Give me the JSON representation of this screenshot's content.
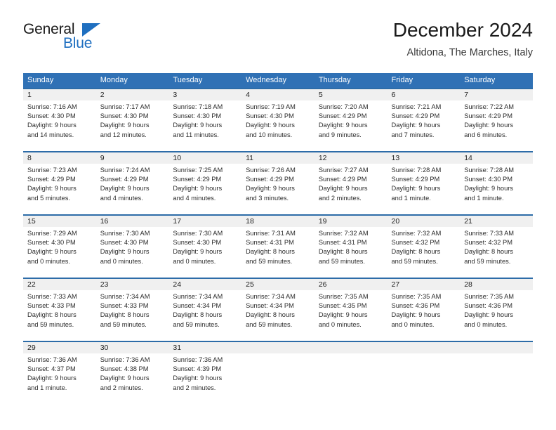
{
  "brand": {
    "name_part1": "General",
    "name_part2": "Blue",
    "accent_color": "#1f6fc0"
  },
  "header": {
    "title": "December 2024",
    "subtitle": "Altidona, The Marches, Italy"
  },
  "theme": {
    "header_blue": "#3071b5",
    "divider_blue": "#2d6ca8",
    "daynum_band": "#f0f0f0"
  },
  "weekdays": [
    "Sunday",
    "Monday",
    "Tuesday",
    "Wednesday",
    "Thursday",
    "Friday",
    "Saturday"
  ],
  "weeks": [
    [
      {
        "day": "1",
        "sunrise": "Sunrise: 7:16 AM",
        "sunset": "Sunset: 4:30 PM",
        "daylight1": "Daylight: 9 hours",
        "daylight2": "and 14 minutes."
      },
      {
        "day": "2",
        "sunrise": "Sunrise: 7:17 AM",
        "sunset": "Sunset: 4:30 PM",
        "daylight1": "Daylight: 9 hours",
        "daylight2": "and 12 minutes."
      },
      {
        "day": "3",
        "sunrise": "Sunrise: 7:18 AM",
        "sunset": "Sunset: 4:30 PM",
        "daylight1": "Daylight: 9 hours",
        "daylight2": "and 11 minutes."
      },
      {
        "day": "4",
        "sunrise": "Sunrise: 7:19 AM",
        "sunset": "Sunset: 4:30 PM",
        "daylight1": "Daylight: 9 hours",
        "daylight2": "and 10 minutes."
      },
      {
        "day": "5",
        "sunrise": "Sunrise: 7:20 AM",
        "sunset": "Sunset: 4:29 PM",
        "daylight1": "Daylight: 9 hours",
        "daylight2": "and 9 minutes."
      },
      {
        "day": "6",
        "sunrise": "Sunrise: 7:21 AM",
        "sunset": "Sunset: 4:29 PM",
        "daylight1": "Daylight: 9 hours",
        "daylight2": "and 7 minutes."
      },
      {
        "day": "7",
        "sunrise": "Sunrise: 7:22 AM",
        "sunset": "Sunset: 4:29 PM",
        "daylight1": "Daylight: 9 hours",
        "daylight2": "and 6 minutes."
      }
    ],
    [
      {
        "day": "8",
        "sunrise": "Sunrise: 7:23 AM",
        "sunset": "Sunset: 4:29 PM",
        "daylight1": "Daylight: 9 hours",
        "daylight2": "and 5 minutes."
      },
      {
        "day": "9",
        "sunrise": "Sunrise: 7:24 AM",
        "sunset": "Sunset: 4:29 PM",
        "daylight1": "Daylight: 9 hours",
        "daylight2": "and 4 minutes."
      },
      {
        "day": "10",
        "sunrise": "Sunrise: 7:25 AM",
        "sunset": "Sunset: 4:29 PM",
        "daylight1": "Daylight: 9 hours",
        "daylight2": "and 4 minutes."
      },
      {
        "day": "11",
        "sunrise": "Sunrise: 7:26 AM",
        "sunset": "Sunset: 4:29 PM",
        "daylight1": "Daylight: 9 hours",
        "daylight2": "and 3 minutes."
      },
      {
        "day": "12",
        "sunrise": "Sunrise: 7:27 AM",
        "sunset": "Sunset: 4:29 PM",
        "daylight1": "Daylight: 9 hours",
        "daylight2": "and 2 minutes."
      },
      {
        "day": "13",
        "sunrise": "Sunrise: 7:28 AM",
        "sunset": "Sunset: 4:29 PM",
        "daylight1": "Daylight: 9 hours",
        "daylight2": "and 1 minute."
      },
      {
        "day": "14",
        "sunrise": "Sunrise: 7:28 AM",
        "sunset": "Sunset: 4:30 PM",
        "daylight1": "Daylight: 9 hours",
        "daylight2": "and 1 minute."
      }
    ],
    [
      {
        "day": "15",
        "sunrise": "Sunrise: 7:29 AM",
        "sunset": "Sunset: 4:30 PM",
        "daylight1": "Daylight: 9 hours",
        "daylight2": "and 0 minutes."
      },
      {
        "day": "16",
        "sunrise": "Sunrise: 7:30 AM",
        "sunset": "Sunset: 4:30 PM",
        "daylight1": "Daylight: 9 hours",
        "daylight2": "and 0 minutes."
      },
      {
        "day": "17",
        "sunrise": "Sunrise: 7:30 AM",
        "sunset": "Sunset: 4:30 PM",
        "daylight1": "Daylight: 9 hours",
        "daylight2": "and 0 minutes."
      },
      {
        "day": "18",
        "sunrise": "Sunrise: 7:31 AM",
        "sunset": "Sunset: 4:31 PM",
        "daylight1": "Daylight: 8 hours",
        "daylight2": "and 59 minutes."
      },
      {
        "day": "19",
        "sunrise": "Sunrise: 7:32 AM",
        "sunset": "Sunset: 4:31 PM",
        "daylight1": "Daylight: 8 hours",
        "daylight2": "and 59 minutes."
      },
      {
        "day": "20",
        "sunrise": "Sunrise: 7:32 AM",
        "sunset": "Sunset: 4:32 PM",
        "daylight1": "Daylight: 8 hours",
        "daylight2": "and 59 minutes."
      },
      {
        "day": "21",
        "sunrise": "Sunrise: 7:33 AM",
        "sunset": "Sunset: 4:32 PM",
        "daylight1": "Daylight: 8 hours",
        "daylight2": "and 59 minutes."
      }
    ],
    [
      {
        "day": "22",
        "sunrise": "Sunrise: 7:33 AM",
        "sunset": "Sunset: 4:33 PM",
        "daylight1": "Daylight: 8 hours",
        "daylight2": "and 59 minutes."
      },
      {
        "day": "23",
        "sunrise": "Sunrise: 7:34 AM",
        "sunset": "Sunset: 4:33 PM",
        "daylight1": "Daylight: 8 hours",
        "daylight2": "and 59 minutes."
      },
      {
        "day": "24",
        "sunrise": "Sunrise: 7:34 AM",
        "sunset": "Sunset: 4:34 PM",
        "daylight1": "Daylight: 8 hours",
        "daylight2": "and 59 minutes."
      },
      {
        "day": "25",
        "sunrise": "Sunrise: 7:34 AM",
        "sunset": "Sunset: 4:34 PM",
        "daylight1": "Daylight: 8 hours",
        "daylight2": "and 59 minutes."
      },
      {
        "day": "26",
        "sunrise": "Sunrise: 7:35 AM",
        "sunset": "Sunset: 4:35 PM",
        "daylight1": "Daylight: 9 hours",
        "daylight2": "and 0 minutes."
      },
      {
        "day": "27",
        "sunrise": "Sunrise: 7:35 AM",
        "sunset": "Sunset: 4:36 PM",
        "daylight1": "Daylight: 9 hours",
        "daylight2": "and 0 minutes."
      },
      {
        "day": "28",
        "sunrise": "Sunrise: 7:35 AM",
        "sunset": "Sunset: 4:36 PM",
        "daylight1": "Daylight: 9 hours",
        "daylight2": "and 0 minutes."
      }
    ],
    [
      {
        "day": "29",
        "sunrise": "Sunrise: 7:36 AM",
        "sunset": "Sunset: 4:37 PM",
        "daylight1": "Daylight: 9 hours",
        "daylight2": "and 1 minute."
      },
      {
        "day": "30",
        "sunrise": "Sunrise: 7:36 AM",
        "sunset": "Sunset: 4:38 PM",
        "daylight1": "Daylight: 9 hours",
        "daylight2": "and 2 minutes."
      },
      {
        "day": "31",
        "sunrise": "Sunrise: 7:36 AM",
        "sunset": "Sunset: 4:39 PM",
        "daylight1": "Daylight: 9 hours",
        "daylight2": "and 2 minutes."
      },
      {
        "day": "",
        "sunrise": "",
        "sunset": "",
        "daylight1": "",
        "daylight2": ""
      },
      {
        "day": "",
        "sunrise": "",
        "sunset": "",
        "daylight1": "",
        "daylight2": ""
      },
      {
        "day": "",
        "sunrise": "",
        "sunset": "",
        "daylight1": "",
        "daylight2": ""
      },
      {
        "day": "",
        "sunrise": "",
        "sunset": "",
        "daylight1": "",
        "daylight2": ""
      }
    ]
  ]
}
